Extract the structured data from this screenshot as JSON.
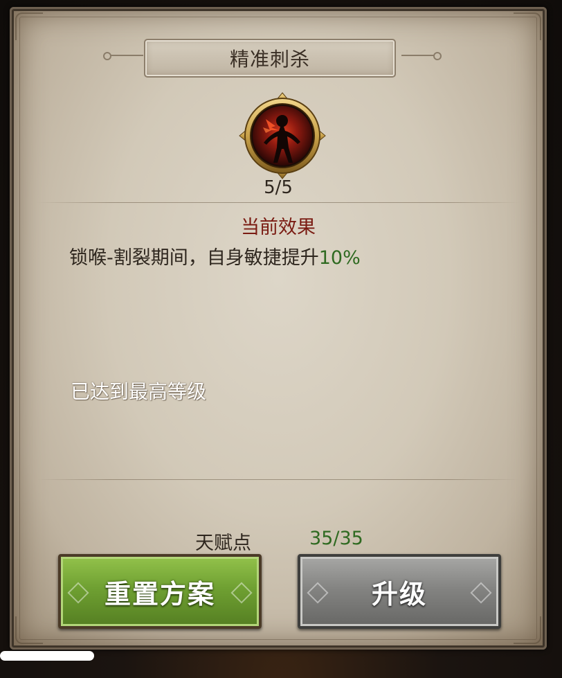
{
  "dialog": {
    "title": "精准刺杀",
    "skill_icon": "assassin-silhouette-icon",
    "level": "5/5",
    "effect_heading": "当前效果",
    "effect_description_prefix": "锁喉-割裂期间，自身敏捷提升",
    "effect_description_value": "10%",
    "max_level_text": "已达到最高等级",
    "talent_points_label": "天赋点",
    "talent_points_value": "35/35"
  },
  "buttons": {
    "reset_label": "重置方案",
    "upgrade_label": "升级"
  },
  "colors": {
    "heading_red": "#7a1b12",
    "highlight_green": "#2f6a21",
    "reset_button_green": "#6fa032",
    "upgrade_button_gray": "#848482",
    "icon_ring_gold": "#c9a24a"
  }
}
